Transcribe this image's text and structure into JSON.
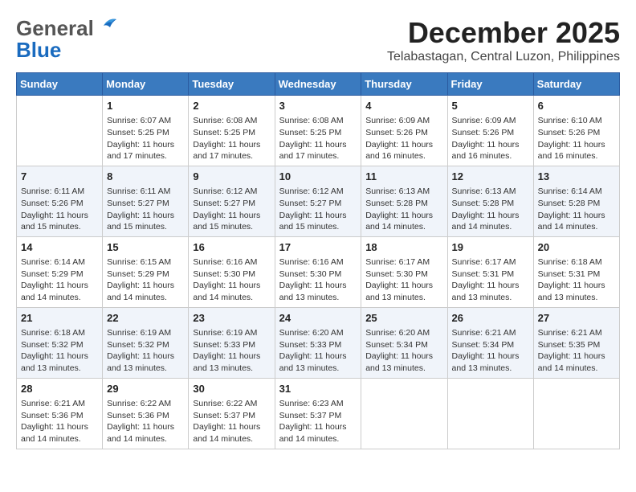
{
  "header": {
    "logo_general": "General",
    "logo_blue": "Blue",
    "month": "December 2025",
    "location": "Telabastagan, Central Luzon, Philippines"
  },
  "weekdays": [
    "Sunday",
    "Monday",
    "Tuesday",
    "Wednesday",
    "Thursday",
    "Friday",
    "Saturday"
  ],
  "weeks": [
    [
      {
        "day": "",
        "sunrise": "",
        "sunset": "",
        "daylight": ""
      },
      {
        "day": "1",
        "sunrise": "Sunrise: 6:07 AM",
        "sunset": "Sunset: 5:25 PM",
        "daylight": "Daylight: 11 hours and 17 minutes."
      },
      {
        "day": "2",
        "sunrise": "Sunrise: 6:08 AM",
        "sunset": "Sunset: 5:25 PM",
        "daylight": "Daylight: 11 hours and 17 minutes."
      },
      {
        "day": "3",
        "sunrise": "Sunrise: 6:08 AM",
        "sunset": "Sunset: 5:25 PM",
        "daylight": "Daylight: 11 hours and 17 minutes."
      },
      {
        "day": "4",
        "sunrise": "Sunrise: 6:09 AM",
        "sunset": "Sunset: 5:26 PM",
        "daylight": "Daylight: 11 hours and 16 minutes."
      },
      {
        "day": "5",
        "sunrise": "Sunrise: 6:09 AM",
        "sunset": "Sunset: 5:26 PM",
        "daylight": "Daylight: 11 hours and 16 minutes."
      },
      {
        "day": "6",
        "sunrise": "Sunrise: 6:10 AM",
        "sunset": "Sunset: 5:26 PM",
        "daylight": "Daylight: 11 hours and 16 minutes."
      }
    ],
    [
      {
        "day": "7",
        "sunrise": "Sunrise: 6:11 AM",
        "sunset": "Sunset: 5:26 PM",
        "daylight": "Daylight: 11 hours and 15 minutes."
      },
      {
        "day": "8",
        "sunrise": "Sunrise: 6:11 AM",
        "sunset": "Sunset: 5:27 PM",
        "daylight": "Daylight: 11 hours and 15 minutes."
      },
      {
        "day": "9",
        "sunrise": "Sunrise: 6:12 AM",
        "sunset": "Sunset: 5:27 PM",
        "daylight": "Daylight: 11 hours and 15 minutes."
      },
      {
        "day": "10",
        "sunrise": "Sunrise: 6:12 AM",
        "sunset": "Sunset: 5:27 PM",
        "daylight": "Daylight: 11 hours and 15 minutes."
      },
      {
        "day": "11",
        "sunrise": "Sunrise: 6:13 AM",
        "sunset": "Sunset: 5:28 PM",
        "daylight": "Daylight: 11 hours and 14 minutes."
      },
      {
        "day": "12",
        "sunrise": "Sunrise: 6:13 AM",
        "sunset": "Sunset: 5:28 PM",
        "daylight": "Daylight: 11 hours and 14 minutes."
      },
      {
        "day": "13",
        "sunrise": "Sunrise: 6:14 AM",
        "sunset": "Sunset: 5:28 PM",
        "daylight": "Daylight: 11 hours and 14 minutes."
      }
    ],
    [
      {
        "day": "14",
        "sunrise": "Sunrise: 6:14 AM",
        "sunset": "Sunset: 5:29 PM",
        "daylight": "Daylight: 11 hours and 14 minutes."
      },
      {
        "day": "15",
        "sunrise": "Sunrise: 6:15 AM",
        "sunset": "Sunset: 5:29 PM",
        "daylight": "Daylight: 11 hours and 14 minutes."
      },
      {
        "day": "16",
        "sunrise": "Sunrise: 6:16 AM",
        "sunset": "Sunset: 5:30 PM",
        "daylight": "Daylight: 11 hours and 14 minutes."
      },
      {
        "day": "17",
        "sunrise": "Sunrise: 6:16 AM",
        "sunset": "Sunset: 5:30 PM",
        "daylight": "Daylight: 11 hours and 13 minutes."
      },
      {
        "day": "18",
        "sunrise": "Sunrise: 6:17 AM",
        "sunset": "Sunset: 5:30 PM",
        "daylight": "Daylight: 11 hours and 13 minutes."
      },
      {
        "day": "19",
        "sunrise": "Sunrise: 6:17 AM",
        "sunset": "Sunset: 5:31 PM",
        "daylight": "Daylight: 11 hours and 13 minutes."
      },
      {
        "day": "20",
        "sunrise": "Sunrise: 6:18 AM",
        "sunset": "Sunset: 5:31 PM",
        "daylight": "Daylight: 11 hours and 13 minutes."
      }
    ],
    [
      {
        "day": "21",
        "sunrise": "Sunrise: 6:18 AM",
        "sunset": "Sunset: 5:32 PM",
        "daylight": "Daylight: 11 hours and 13 minutes."
      },
      {
        "day": "22",
        "sunrise": "Sunrise: 6:19 AM",
        "sunset": "Sunset: 5:32 PM",
        "daylight": "Daylight: 11 hours and 13 minutes."
      },
      {
        "day": "23",
        "sunrise": "Sunrise: 6:19 AM",
        "sunset": "Sunset: 5:33 PM",
        "daylight": "Daylight: 11 hours and 13 minutes."
      },
      {
        "day": "24",
        "sunrise": "Sunrise: 6:20 AM",
        "sunset": "Sunset: 5:33 PM",
        "daylight": "Daylight: 11 hours and 13 minutes."
      },
      {
        "day": "25",
        "sunrise": "Sunrise: 6:20 AM",
        "sunset": "Sunset: 5:34 PM",
        "daylight": "Daylight: 11 hours and 13 minutes."
      },
      {
        "day": "26",
        "sunrise": "Sunrise: 6:21 AM",
        "sunset": "Sunset: 5:34 PM",
        "daylight": "Daylight: 11 hours and 13 minutes."
      },
      {
        "day": "27",
        "sunrise": "Sunrise: 6:21 AM",
        "sunset": "Sunset: 5:35 PM",
        "daylight": "Daylight: 11 hours and 14 minutes."
      }
    ],
    [
      {
        "day": "28",
        "sunrise": "Sunrise: 6:21 AM",
        "sunset": "Sunset: 5:36 PM",
        "daylight": "Daylight: 11 hours and 14 minutes."
      },
      {
        "day": "29",
        "sunrise": "Sunrise: 6:22 AM",
        "sunset": "Sunset: 5:36 PM",
        "daylight": "Daylight: 11 hours and 14 minutes."
      },
      {
        "day": "30",
        "sunrise": "Sunrise: 6:22 AM",
        "sunset": "Sunset: 5:37 PM",
        "daylight": "Daylight: 11 hours and 14 minutes."
      },
      {
        "day": "31",
        "sunrise": "Sunrise: 6:23 AM",
        "sunset": "Sunset: 5:37 PM",
        "daylight": "Daylight: 11 hours and 14 minutes."
      },
      {
        "day": "",
        "sunrise": "",
        "sunset": "",
        "daylight": ""
      },
      {
        "day": "",
        "sunrise": "",
        "sunset": "",
        "daylight": ""
      },
      {
        "day": "",
        "sunrise": "",
        "sunset": "",
        "daylight": ""
      }
    ]
  ]
}
